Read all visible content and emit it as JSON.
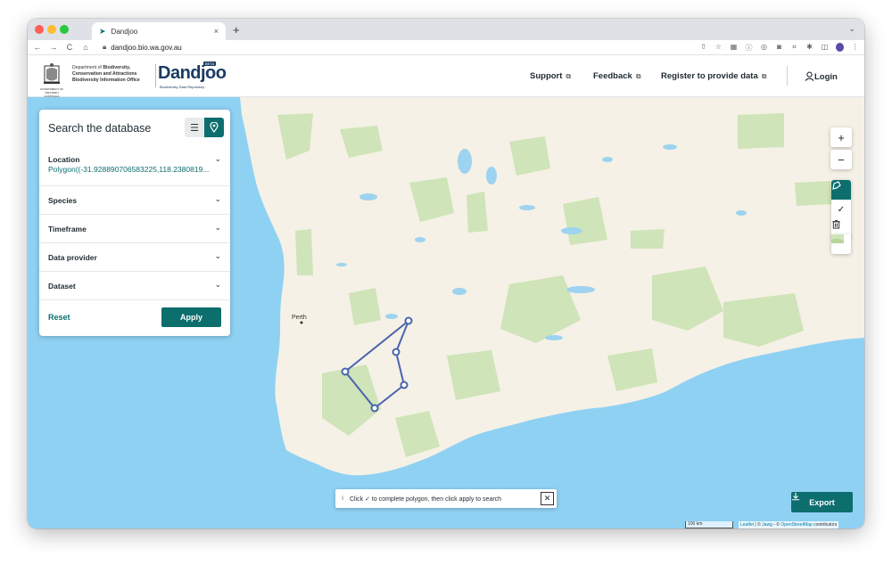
{
  "browser": {
    "tab_title": "Dandjoo",
    "tab_close": "×",
    "new_tab": "+",
    "url": "dandjoo.bio.wa.gov.au",
    "nav_back": "←",
    "nav_forward": "→",
    "nav_reload": "C",
    "nav_home": "⌂",
    "traffic_colors": [
      "#ff5f57",
      "#febc2e",
      "#28c840"
    ]
  },
  "header": {
    "dept_line1_prefix": "Department of ",
    "dept_line1_bold": "Biodiversity,",
    "dept_line2": "Conservation and Attractions",
    "dept_line3": "Biodiversity Information Office",
    "crest_caption": "GOVERNMENT OF WESTERN AUSTRALIA",
    "brand": "Dandjoo",
    "beta": "BETA",
    "brand_sub": "Biodiversity Data Repository",
    "nav": {
      "support": "Support",
      "feedback": "Feedback",
      "register": "Register to provide data",
      "login": "Login"
    }
  },
  "panel": {
    "title": "Search the database",
    "sections": [
      {
        "label": "Location",
        "value": "Polygon((-31.928890706583225,118.2380819..."
      },
      {
        "label": "Species"
      },
      {
        "label": "Timeframe"
      },
      {
        "label": "Data provider"
      },
      {
        "label": "Dataset"
      }
    ],
    "reset": "Reset",
    "apply": "Apply"
  },
  "map": {
    "zoom_in": "+",
    "zoom_out": "−",
    "place_label": "Perth",
    "hint_icon": "i",
    "hint_text": "Click ✓ to complete polygon, then click apply to search",
    "hint_close": "✕",
    "export_label": "Export",
    "scale_label": "100 km",
    "attribution_leaflet": "Leaflet",
    "attribution_sep1": " | © ",
    "attribution_jawg": "Jawg",
    "attribution_sep2": " - © ",
    "attribution_osm": "OpenStreetMap",
    "attribution_tail": " contributors"
  },
  "colors": {
    "accent": "#0d6e6e",
    "brand_navy": "#1b3c63",
    "ocean": "#8fd1f3",
    "land": "#f5f1e6",
    "polygon": "#4a63b0"
  }
}
